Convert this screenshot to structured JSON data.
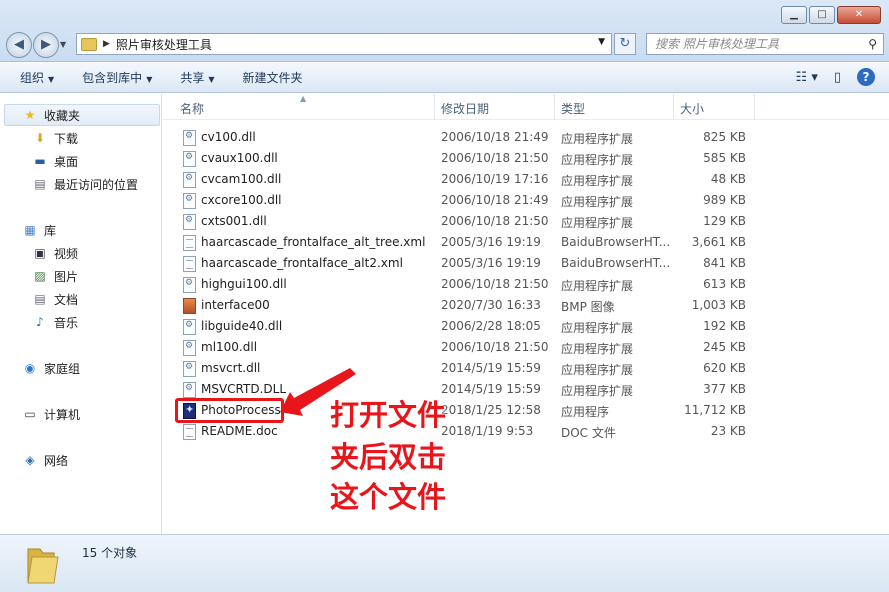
{
  "window": {
    "minimize_glyph": "▁",
    "maximize_glyph": "□",
    "close_glyph": "✕"
  },
  "address": {
    "path": "照片审核处理工具",
    "search_placeholder": "搜索 照片审核处理工具"
  },
  "toolbar": {
    "organize": "组织",
    "include_in_library": "包含到库中",
    "share": "共享",
    "new_folder": "新建文件夹"
  },
  "sidebar": {
    "favorites": "收藏夹",
    "downloads": "下载",
    "desktop": "桌面",
    "recent": "最近访问的位置",
    "libraries": "库",
    "videos": "视频",
    "pictures": "图片",
    "documents": "文档",
    "music": "音乐",
    "homegroup": "家庭组",
    "computer": "计算机",
    "network": "网络"
  },
  "columns": {
    "name": "名称",
    "date": "修改日期",
    "type": "类型",
    "size": "大小"
  },
  "files": [
    {
      "name": "cv100.dll",
      "date": "2006/10/18 21:49",
      "type": "应用程序扩展",
      "size": "825 KB",
      "icon": "dll"
    },
    {
      "name": "cvaux100.dll",
      "date": "2006/10/18 21:50",
      "type": "应用程序扩展",
      "size": "585 KB",
      "icon": "dll"
    },
    {
      "name": "cvcam100.dll",
      "date": "2006/10/19 17:16",
      "type": "应用程序扩展",
      "size": "48 KB",
      "icon": "dll"
    },
    {
      "name": "cxcore100.dll",
      "date": "2006/10/18 21:49",
      "type": "应用程序扩展",
      "size": "989 KB",
      "icon": "dll"
    },
    {
      "name": "cxts001.dll",
      "date": "2006/10/18 21:50",
      "type": "应用程序扩展",
      "size": "129 KB",
      "icon": "dll"
    },
    {
      "name": "haarcascade_frontalface_alt_tree.xml",
      "date": "2005/3/16 19:19",
      "type": "BaiduBrowserHT...",
      "size": "3,661 KB",
      "icon": "doc"
    },
    {
      "name": "haarcascade_frontalface_alt2.xml",
      "date": "2005/3/16 19:19",
      "type": "BaiduBrowserHT...",
      "size": "841 KB",
      "icon": "doc"
    },
    {
      "name": "highgui100.dll",
      "date": "2006/10/18 21:50",
      "type": "应用程序扩展",
      "size": "613 KB",
      "icon": "dll"
    },
    {
      "name": "interface00",
      "date": "2020/7/30 16:33",
      "type": "BMP 图像",
      "size": "1,003 KB",
      "icon": "bmp"
    },
    {
      "name": "libguide40.dll",
      "date": "2006/2/28 18:05",
      "type": "应用程序扩展",
      "size": "192 KB",
      "icon": "dll"
    },
    {
      "name": "ml100.dll",
      "date": "2006/10/18 21:50",
      "type": "应用程序扩展",
      "size": "245 KB",
      "icon": "dll"
    },
    {
      "name": "msvcrt.dll",
      "date": "2014/5/19 15:59",
      "type": "应用程序扩展",
      "size": "620 KB",
      "icon": "dll"
    },
    {
      "name": "MSVCRTD.DLL",
      "date": "2014/5/19 15:59",
      "type": "应用程序扩展",
      "size": "377 KB",
      "icon": "dll"
    },
    {
      "name": "PhotoProcess",
      "date": "2018/1/25 12:58",
      "type": "应用程序",
      "size": "11,712 KB",
      "icon": "exe"
    },
    {
      "name": "README.doc",
      "date": "2018/1/19 9:53",
      "type": "DOC 文件",
      "size": "23 KB",
      "icon": "doc"
    }
  ],
  "annotation": {
    "line1": "打开文件",
    "line2": "夹后双击",
    "line3": "这个文件",
    "color": "#e8161b"
  },
  "status": {
    "count": "15 个对象"
  }
}
